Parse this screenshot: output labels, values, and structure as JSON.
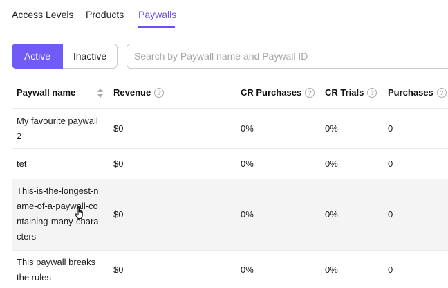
{
  "tabs": [
    {
      "label": "Access Levels"
    },
    {
      "label": "Products"
    },
    {
      "label": "Paywalls",
      "active": true
    }
  ],
  "filter": {
    "active_label": "Active",
    "inactive_label": "Inactive",
    "selected": "Active"
  },
  "search": {
    "placeholder": "Search by Paywall name and Paywall ID",
    "value": ""
  },
  "table": {
    "columns": [
      {
        "label": "Paywall name",
        "sortable": true
      },
      {
        "label": "Revenue",
        "help": true
      },
      {
        "label": "CR Purchases",
        "help": true
      },
      {
        "label": "CR Trials",
        "help": true
      },
      {
        "label": "Purchases",
        "help": true
      }
    ],
    "rows": [
      {
        "name": "My favourite paywall 2",
        "revenue": "$0",
        "cr_purchases": "0%",
        "cr_trials": "0%",
        "purchases": "0"
      },
      {
        "name": "tet",
        "revenue": "$0",
        "cr_purchases": "0%",
        "cr_trials": "0%",
        "purchases": "0"
      },
      {
        "name": "This-is-the-longest-name-of-a-paywall-containing-many-characters",
        "revenue": "$0",
        "cr_purchases": "0%",
        "cr_trials": "0%",
        "purchases": "0",
        "hovered": true
      },
      {
        "name": "This paywall breaks the rules",
        "revenue": "$0",
        "cr_purchases": "0%",
        "cr_trials": "0%",
        "purchases": "0"
      }
    ]
  },
  "colors": {
    "accent": "#6f4cf5",
    "active_button": "#6f5cf6",
    "row_hover": "#f4f4f5",
    "border": "#c9c9cf"
  },
  "icons": {
    "help": "question-circle-icon",
    "sort": "sort-arrows-icon",
    "cursor": "hand-pointer-icon"
  }
}
